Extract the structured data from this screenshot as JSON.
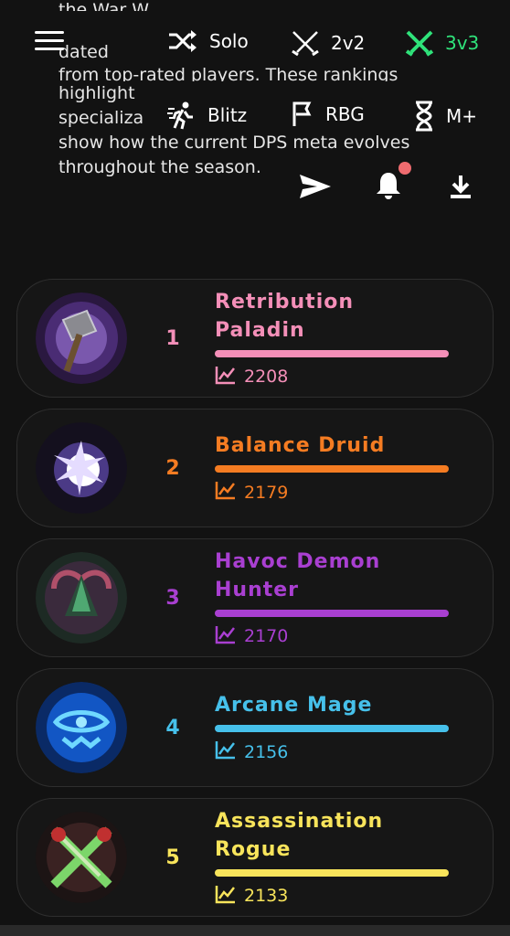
{
  "background_text": {
    "line1": "the War W",
    "line2": "dated",
    "line3": "from top-rated players. These rankings",
    "line4": "highlight",
    "line5": "specializa",
    "line6": "show how the current DPS meta evolves",
    "line7": "throughout the season."
  },
  "menu": {
    "icon": "hamburger-menu-icon"
  },
  "modes": [
    {
      "label": "Solo",
      "icon": "shuffle-icon",
      "active": false
    },
    {
      "label": "2v2",
      "icon": "crossed-swords-icon",
      "active": false
    },
    {
      "label": "3v3",
      "icon": "crossed-swords-icon",
      "active": true
    },
    {
      "label": "Blitz",
      "icon": "running-icon",
      "active": false
    },
    {
      "label": "RBG",
      "icon": "flag-icon",
      "active": false
    },
    {
      "label": "M+",
      "icon": "hourglass-icon",
      "active": false
    }
  ],
  "actions": {
    "share": "send-icon",
    "notifications": "bell-icon",
    "download": "download-icon"
  },
  "colors": {
    "active": "#2fe27a",
    "badge": "#ef6b6f"
  },
  "rankings": [
    {
      "rank": "1",
      "name": "Retribution Paladin",
      "rating": "2208",
      "color": "#f48fb8",
      "icon": "hammer-icon"
    },
    {
      "rank": "2",
      "name": "Balance Druid",
      "rating": "2179",
      "color": "#f57c22",
      "icon": "starburst-icon"
    },
    {
      "rank": "3",
      "name": "Havoc Demon Hunter",
      "rating": "2170",
      "color": "#a93fd1",
      "icon": "demon-icon"
    },
    {
      "rank": "4",
      "name": "Arcane Mage",
      "rating": "2156",
      "color": "#46c0ea",
      "icon": "arcane-rune-icon"
    },
    {
      "rank": "5",
      "name": "Assassination Rogue",
      "rating": "2133",
      "color": "#f8e45b",
      "icon": "crossed-daggers-icon"
    }
  ]
}
